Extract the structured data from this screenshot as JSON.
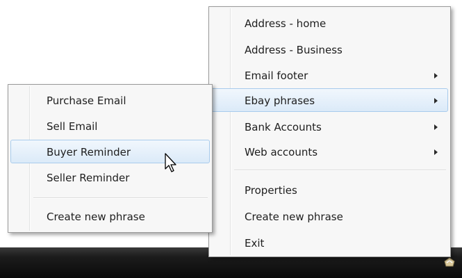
{
  "main_menu": {
    "items": [
      {
        "label": "Address - home"
      },
      {
        "label": "Address - Business"
      },
      {
        "label": "Email footer",
        "has_submenu": true
      },
      {
        "label": "Ebay phrases",
        "has_submenu": true,
        "highlighted": true
      },
      {
        "label": "Bank Accounts",
        "has_submenu": true
      },
      {
        "label": "Web accounts",
        "has_submenu": true
      },
      {
        "label": "Properties"
      },
      {
        "label": "Create new phrase"
      },
      {
        "label": "Exit"
      }
    ]
  },
  "sub_menu": {
    "items": [
      {
        "label": "Purchase Email"
      },
      {
        "label": "Sell Email"
      },
      {
        "label": "Buyer Reminder",
        "highlighted": true
      },
      {
        "label": "Seller Reminder"
      },
      {
        "label": "Create new phrase"
      }
    ]
  },
  "colors": {
    "highlight_top": "#f1f7fd",
    "highlight_bottom": "#dbeaf8",
    "highlight_border": "#a8cbec",
    "menu_bg": "#f7f7f7",
    "taskbar": "#0a0a0a"
  },
  "icons": {
    "cursor": "arrow-cursor-icon",
    "tray": "tray-app-icon",
    "submenu": "submenu-arrow-icon"
  }
}
